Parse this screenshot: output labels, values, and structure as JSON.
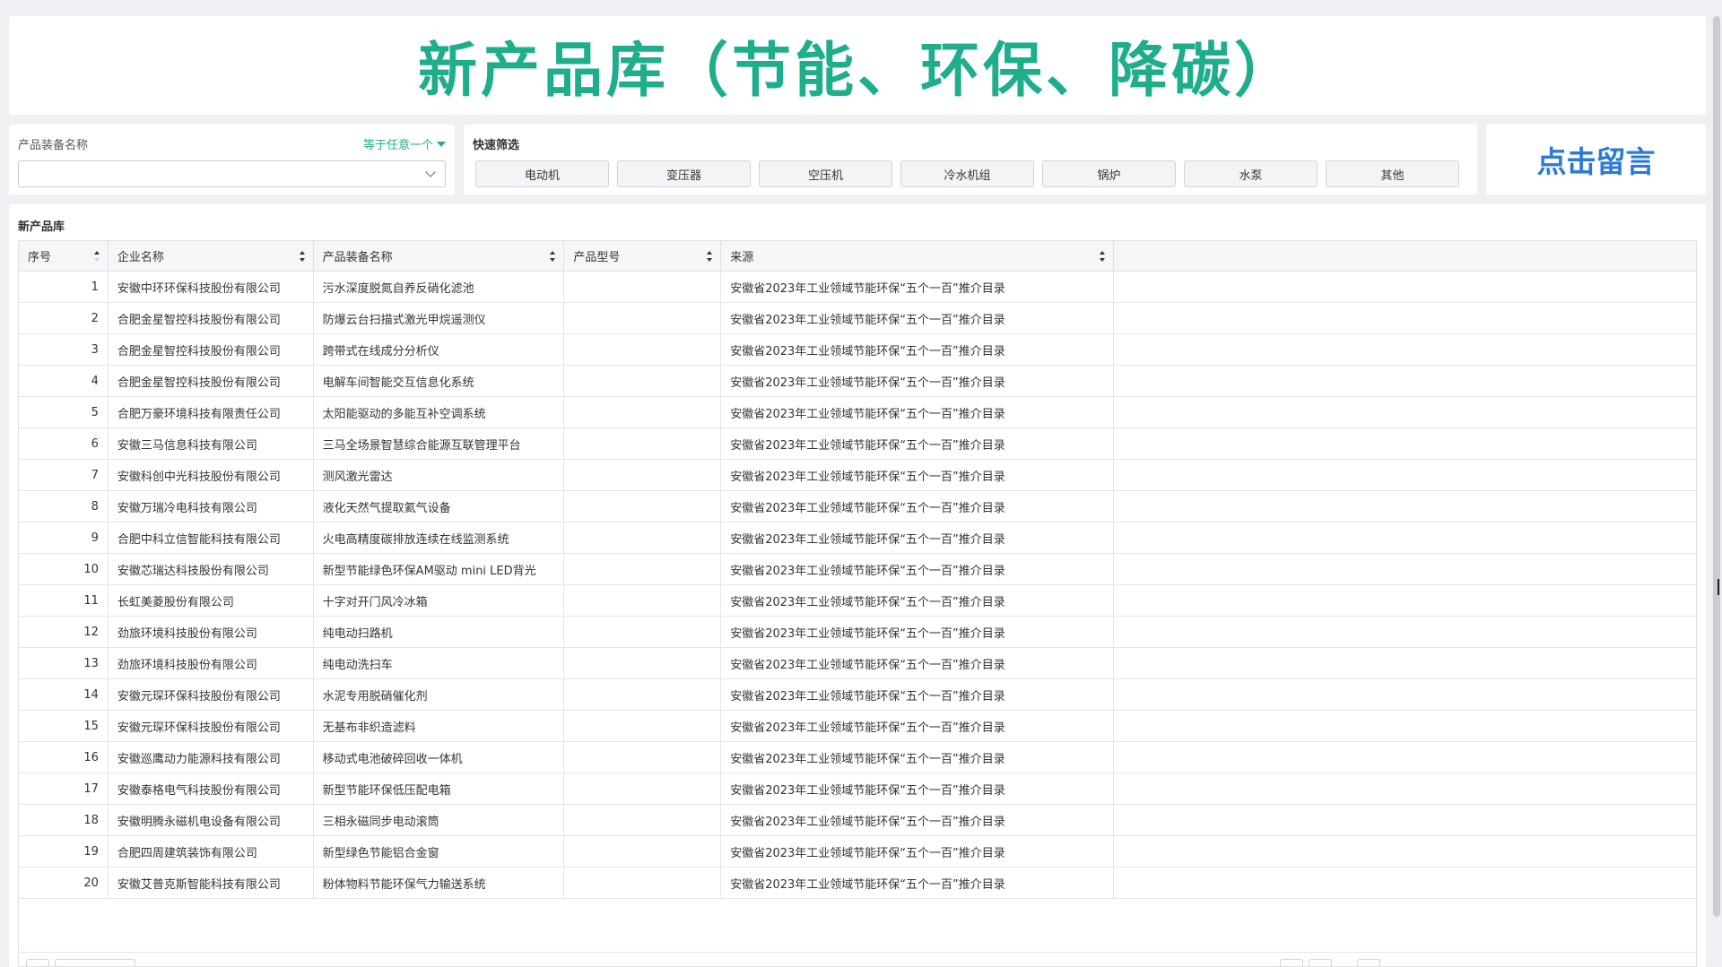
{
  "title": "新产品库（节能、环保、降碳）",
  "filter": {
    "label": "产品装备名称",
    "operator": "等于任意一个",
    "selected": ""
  },
  "quick_filter": {
    "title": "快速筛选",
    "buttons": [
      "电动机",
      "变压器",
      "空压机",
      "冷水机组",
      "锅炉",
      "水泵",
      "其他"
    ]
  },
  "message_button": "点击留言",
  "table": {
    "title": "新产品库",
    "columns": [
      "序号",
      "企业名称",
      "产品装备名称",
      "产品型号",
      "来源"
    ],
    "rows": [
      [
        "1",
        "安徽中环环保科技股份有限公司",
        "污水深度脱氮自养反硝化滤池",
        "",
        "安徽省2023年工业领域节能环保“五个一百”推介目录"
      ],
      [
        "2",
        "合肥金星智控科技股份有限公司",
        "防爆云台扫描式激光甲烷遥测仪",
        "",
        "安徽省2023年工业领域节能环保“五个一百”推介目录"
      ],
      [
        "3",
        "合肥金星智控科技股份有限公司",
        "跨带式在线成分分析仪",
        "",
        "安徽省2023年工业领域节能环保“五个一百”推介目录"
      ],
      [
        "4",
        "合肥金星智控科技股份有限公司",
        "电解车间智能交互信息化系统",
        "",
        "安徽省2023年工业领域节能环保“五个一百”推介目录"
      ],
      [
        "5",
        "合肥万豪环境科技有限责任公司",
        "太阳能驱动的多能互补空调系统",
        "",
        "安徽省2023年工业领域节能环保“五个一百”推介目录"
      ],
      [
        "6",
        "安徽三马信息科技有限公司",
        "三马全场景智慧综合能源互联管理平台",
        "",
        "安徽省2023年工业领域节能环保“五个一百”推介目录"
      ],
      [
        "7",
        "安徽科创中光科技股份有限公司",
        "测风激光雷达",
        "",
        "安徽省2023年工业领域节能环保“五个一百”推介目录"
      ],
      [
        "8",
        "安徽万瑞冷电科技有限公司",
        "液化天然气提取氦气设备",
        "",
        "安徽省2023年工业领域节能环保“五个一百”推介目录"
      ],
      [
        "9",
        "合肥中科立信智能科技有限公司",
        "火电高精度碳排放连续在线监测系统",
        "",
        "安徽省2023年工业领域节能环保“五个一百”推介目录"
      ],
      [
        "10",
        "安徽芯瑞达科技股份有限公司",
        "新型节能绿色环保AM驱动 mini LED背光",
        "",
        "安徽省2023年工业领域节能环保“五个一百”推介目录"
      ],
      [
        "11",
        "长虹美菱股份有限公司",
        "十字对开门风冷冰箱",
        "",
        "安徽省2023年工业领域节能环保“五个一百”推介目录"
      ],
      [
        "12",
        "劲旅环境科技股份有限公司",
        "纯电动扫路机",
        "",
        "安徽省2023年工业领域节能环保“五个一百”推介目录"
      ],
      [
        "13",
        "劲旅环境科技股份有限公司",
        "纯电动洗扫车",
        "",
        "安徽省2023年工业领域节能环保“五个一百”推介目录"
      ],
      [
        "14",
        "安徽元琛环保科技股份有限公司",
        "水泥专用脱硝催化剂",
        "",
        "安徽省2023年工业领域节能环保“五个一百”推介目录"
      ],
      [
        "15",
        "安徽元琛环保科技股份有限公司",
        "无基布非织造滤料",
        "",
        "安徽省2023年工业领域节能环保“五个一百”推介目录"
      ],
      [
        "16",
        "安徽巡鹰动力能源科技有限公司",
        "移动式电池破碎回收一体机",
        "",
        "安徽省2023年工业领域节能环保“五个一百”推介目录"
      ],
      [
        "17",
        "安徽泰格电气科技股份有限公司",
        "新型节能环保低压配电箱",
        "",
        "安徽省2023年工业领域节能环保“五个一百”推介目录"
      ],
      [
        "18",
        "安徽明腾永磁机电设备有限公司",
        "三相永磁同步电动滚筒",
        "",
        "安徽省2023年工业领域节能环保“五个一百”推介目录"
      ],
      [
        "19",
        "合肥四周建筑装饰有限公司",
        "新型绿色节能铝合金窗",
        "",
        "安徽省2023年工业领域节能环保“五个一百”推介目录"
      ],
      [
        "20",
        "安徽艾普克斯智能科技有限公司",
        "粉体物料节能环保气力输送系统",
        "",
        "安徽省2023年工业领域节能环保“五个一百”推介目录"
      ]
    ]
  },
  "colors": {
    "title": "#1fae8c",
    "message": "#2b7ad6",
    "accent": "#1fae8c"
  }
}
